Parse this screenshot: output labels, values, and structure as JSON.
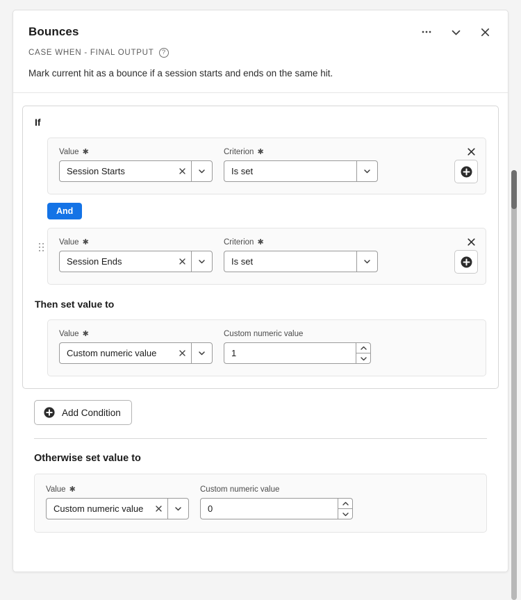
{
  "header": {
    "title": "Bounces",
    "subtitle": "CASE WHEN - FINAL OUTPUT",
    "help_icon": "?",
    "description": "Mark current hit as a bounce if a session starts and ends on the same hit.",
    "more_icon": "more-horizontal-icon",
    "collapse_icon": "chevron-down-icon",
    "close_icon": "close-icon"
  },
  "rule": {
    "if_label": "If",
    "then_label": "Then set value to",
    "and_badge": "And",
    "conditions": [
      {
        "value_label": "Value",
        "value_required": "✱",
        "value": "Session Starts",
        "criterion_label": "Criterion",
        "criterion_required": "✱",
        "criterion": "Is set"
      },
      {
        "value_label": "Value",
        "value_required": "✱",
        "value": "Session Ends",
        "criterion_label": "Criterion",
        "criterion_required": "✱",
        "criterion": "Is set"
      }
    ],
    "then": {
      "value_label": "Value",
      "value_required": "✱",
      "value": "Custom numeric value",
      "numeric_label": "Custom numeric value",
      "numeric_value": "1"
    }
  },
  "add_condition": {
    "label": "Add Condition",
    "icon": "plus-circle-icon"
  },
  "otherwise": {
    "heading": "Otherwise set value to",
    "value_label": "Value",
    "value_required": "✱",
    "value": "Custom numeric value",
    "numeric_label": "Custom numeric value",
    "numeric_value": "0"
  },
  "colors": {
    "accent_blue": "#1473e6",
    "panel_bg": "#fafafa",
    "page_bg": "#f4f4f4",
    "border": "#d6d6d6",
    "scrollbar_thumb": "#6e6e6e",
    "scrollbar_track": "#b8b8b8"
  }
}
